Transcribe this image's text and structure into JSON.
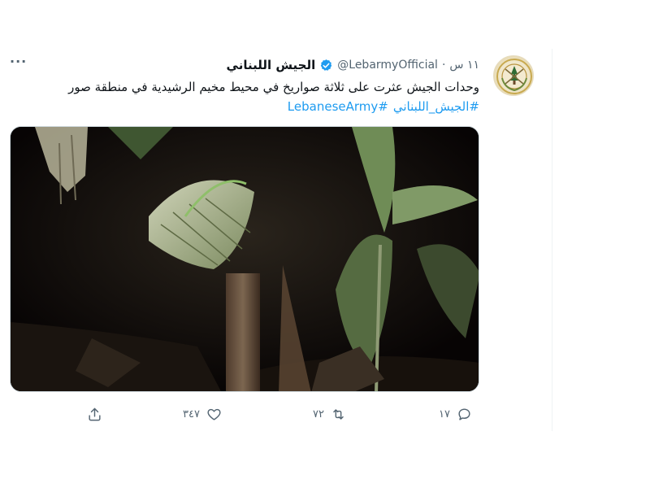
{
  "tweet": {
    "display_name": "الجيش اللبناني",
    "handle": "@LebarmyOfficial",
    "separator": "·",
    "time": "١١ س",
    "text": "وحدات الجيش عثرت على ثلاثة صواريخ في محيط مخيم الرشيدية في منطقة صور",
    "hashtags": [
      "#الجيش_اللبناني",
      "#LebaneseArmy"
    ],
    "more_label": "···"
  },
  "actions": {
    "reply_count": "١٧",
    "retweet_count": "٧٢",
    "like_count": "٣٤٧"
  },
  "colors": {
    "link": "#1d9bf0",
    "secondary": "#536471",
    "verified": "#1d9bf0",
    "media_bg": "#0b0707"
  },
  "icons": {
    "avatar": "lebanese-army-emblem",
    "verified": "verified-badge-icon",
    "reply": "reply-icon",
    "retweet": "retweet-icon",
    "like": "heart-icon",
    "share": "share-icon",
    "more": "more-icon"
  }
}
